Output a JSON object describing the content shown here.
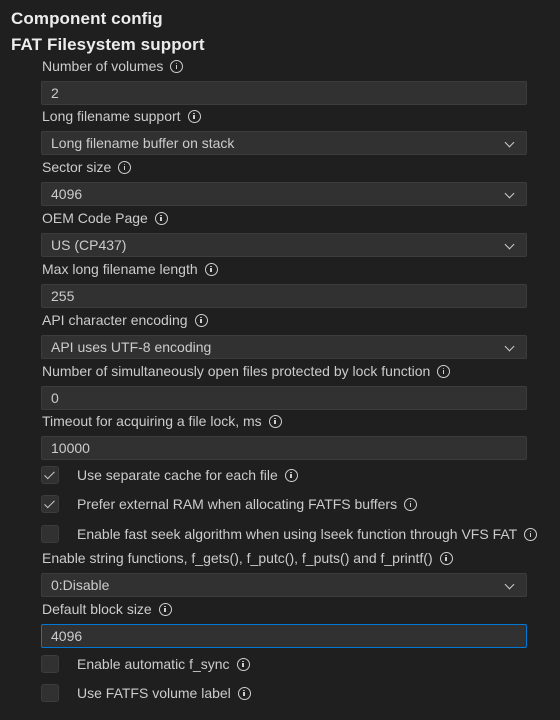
{
  "header": {
    "title": "Component config",
    "section": "FAT Filesystem support"
  },
  "settings": {
    "num_volumes": {
      "label": "Number of volumes",
      "value": "2"
    },
    "lfn_support": {
      "label": "Long filename support",
      "value": "Long filename buffer on stack"
    },
    "sector_size": {
      "label": "Sector size",
      "value": "4096"
    },
    "oem_code_page": {
      "label": "OEM Code Page",
      "value": "US (CP437)"
    },
    "max_lfn_length": {
      "label": "Max long filename length",
      "value": "255"
    },
    "api_encoding": {
      "label": "API character encoding",
      "value": "API uses UTF-8 encoding"
    },
    "open_files_lock": {
      "label": "Number of simultaneously open files protected by lock function",
      "value": "0"
    },
    "lock_timeout": {
      "label": "Timeout for acquiring a file lock, ms",
      "value": "10000"
    },
    "separate_cache": {
      "label": "Use separate cache for each file",
      "checked": true
    },
    "prefer_ext_ram": {
      "label": "Prefer external RAM when allocating FATFS buffers",
      "checked": true
    },
    "fast_seek": {
      "label": "Enable fast seek algorithm when using lseek function through VFS FAT",
      "checked": false
    },
    "string_funcs": {
      "label": "Enable string functions, f_gets(), f_putc(), f_puts() and f_printf()",
      "value": "0:Disable"
    },
    "block_size": {
      "label": "Default block size",
      "value": "4096"
    },
    "auto_fsync": {
      "label": "Enable automatic f_sync",
      "checked": false
    },
    "volume_label": {
      "label": "Use FATFS volume label",
      "checked": false
    }
  },
  "icons": {
    "info": "info-icon",
    "dropdown": "chevron-down-icon",
    "check": "checkmark-icon"
  },
  "colors": {
    "background": "#1f1f1f",
    "field_bg": "#313131",
    "field_border": "#3c3c3c",
    "focus_border": "#0078d4",
    "text": "#cccccc"
  }
}
